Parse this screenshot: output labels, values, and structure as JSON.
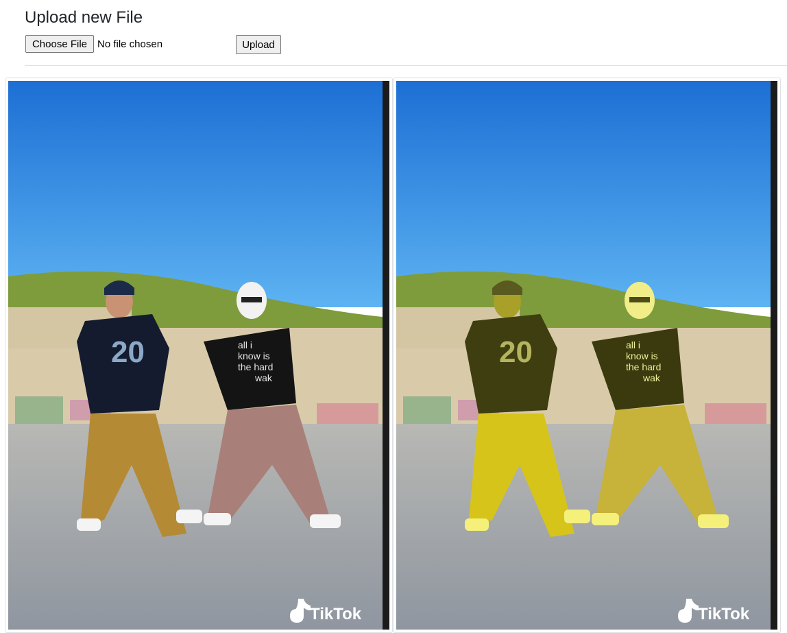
{
  "header": {
    "title": "Upload new File"
  },
  "upload_form": {
    "choose_label": "Choose File",
    "file_status": "No file chosen",
    "submit_label": "Upload"
  },
  "images": [
    {
      "name": "original-frame",
      "watermark": "TikTok"
    },
    {
      "name": "segmented-frame",
      "watermark": "TikTok",
      "overlay_color": "#e8e000"
    }
  ],
  "jersey_number": "20",
  "shirt_text": [
    "all i",
    "know is",
    "the hard",
    "wak"
  ],
  "colors": {
    "sky_top": "#1d72d6",
    "sky_bottom": "#5bb0f0",
    "hill": "#7a9a3a",
    "wall": "#d8c9a8",
    "ground": "#9ea3a8",
    "mask": "#e8e000"
  }
}
